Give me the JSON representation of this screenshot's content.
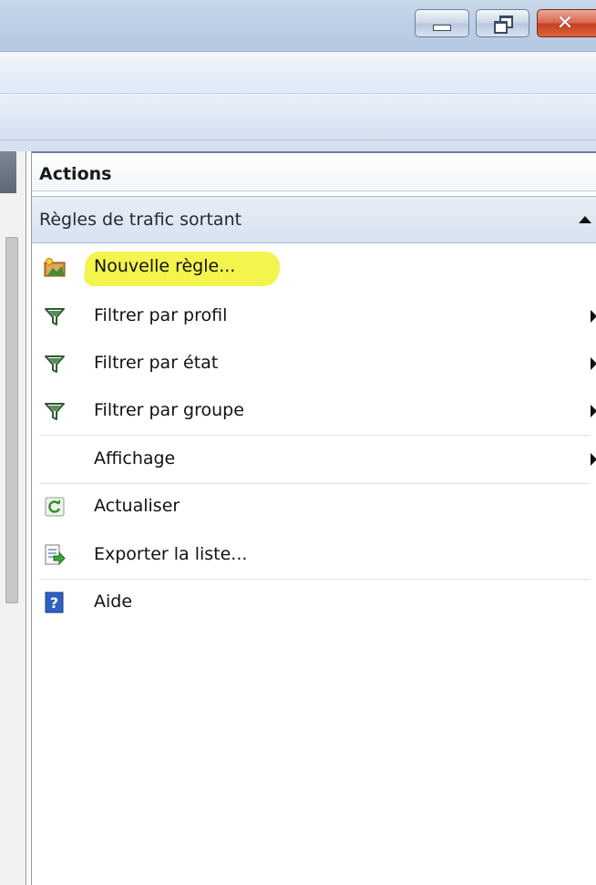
{
  "window": {
    "buttons": {
      "minimize": "minimize",
      "restore": "restore",
      "close": "close"
    }
  },
  "actions": {
    "title": "Actions",
    "section": "Règles de trafic sortant",
    "items": [
      {
        "label": "Nouvelle règle...",
        "icon": "new-rule-icon",
        "highlighted": true
      },
      {
        "label": "Filtrer par profil",
        "icon": "filter-icon",
        "submenu": true
      },
      {
        "label": "Filtrer par état",
        "icon": "filter-icon",
        "submenu": true
      },
      {
        "label": "Filtrer par groupe",
        "icon": "filter-icon",
        "submenu": true
      },
      {
        "label": "Affichage",
        "icon": "",
        "submenu": true
      },
      {
        "label": "Actualiser",
        "icon": "refresh-icon"
      },
      {
        "label": "Exporter la liste...",
        "icon": "export-list-icon"
      },
      {
        "label": "Aide",
        "icon": "help-icon"
      }
    ]
  },
  "colors": {
    "highlight": "#f1f22e",
    "section_bg": "#dde6f2",
    "titlebar": "#bccfe6",
    "close_button": "#d9634d"
  }
}
